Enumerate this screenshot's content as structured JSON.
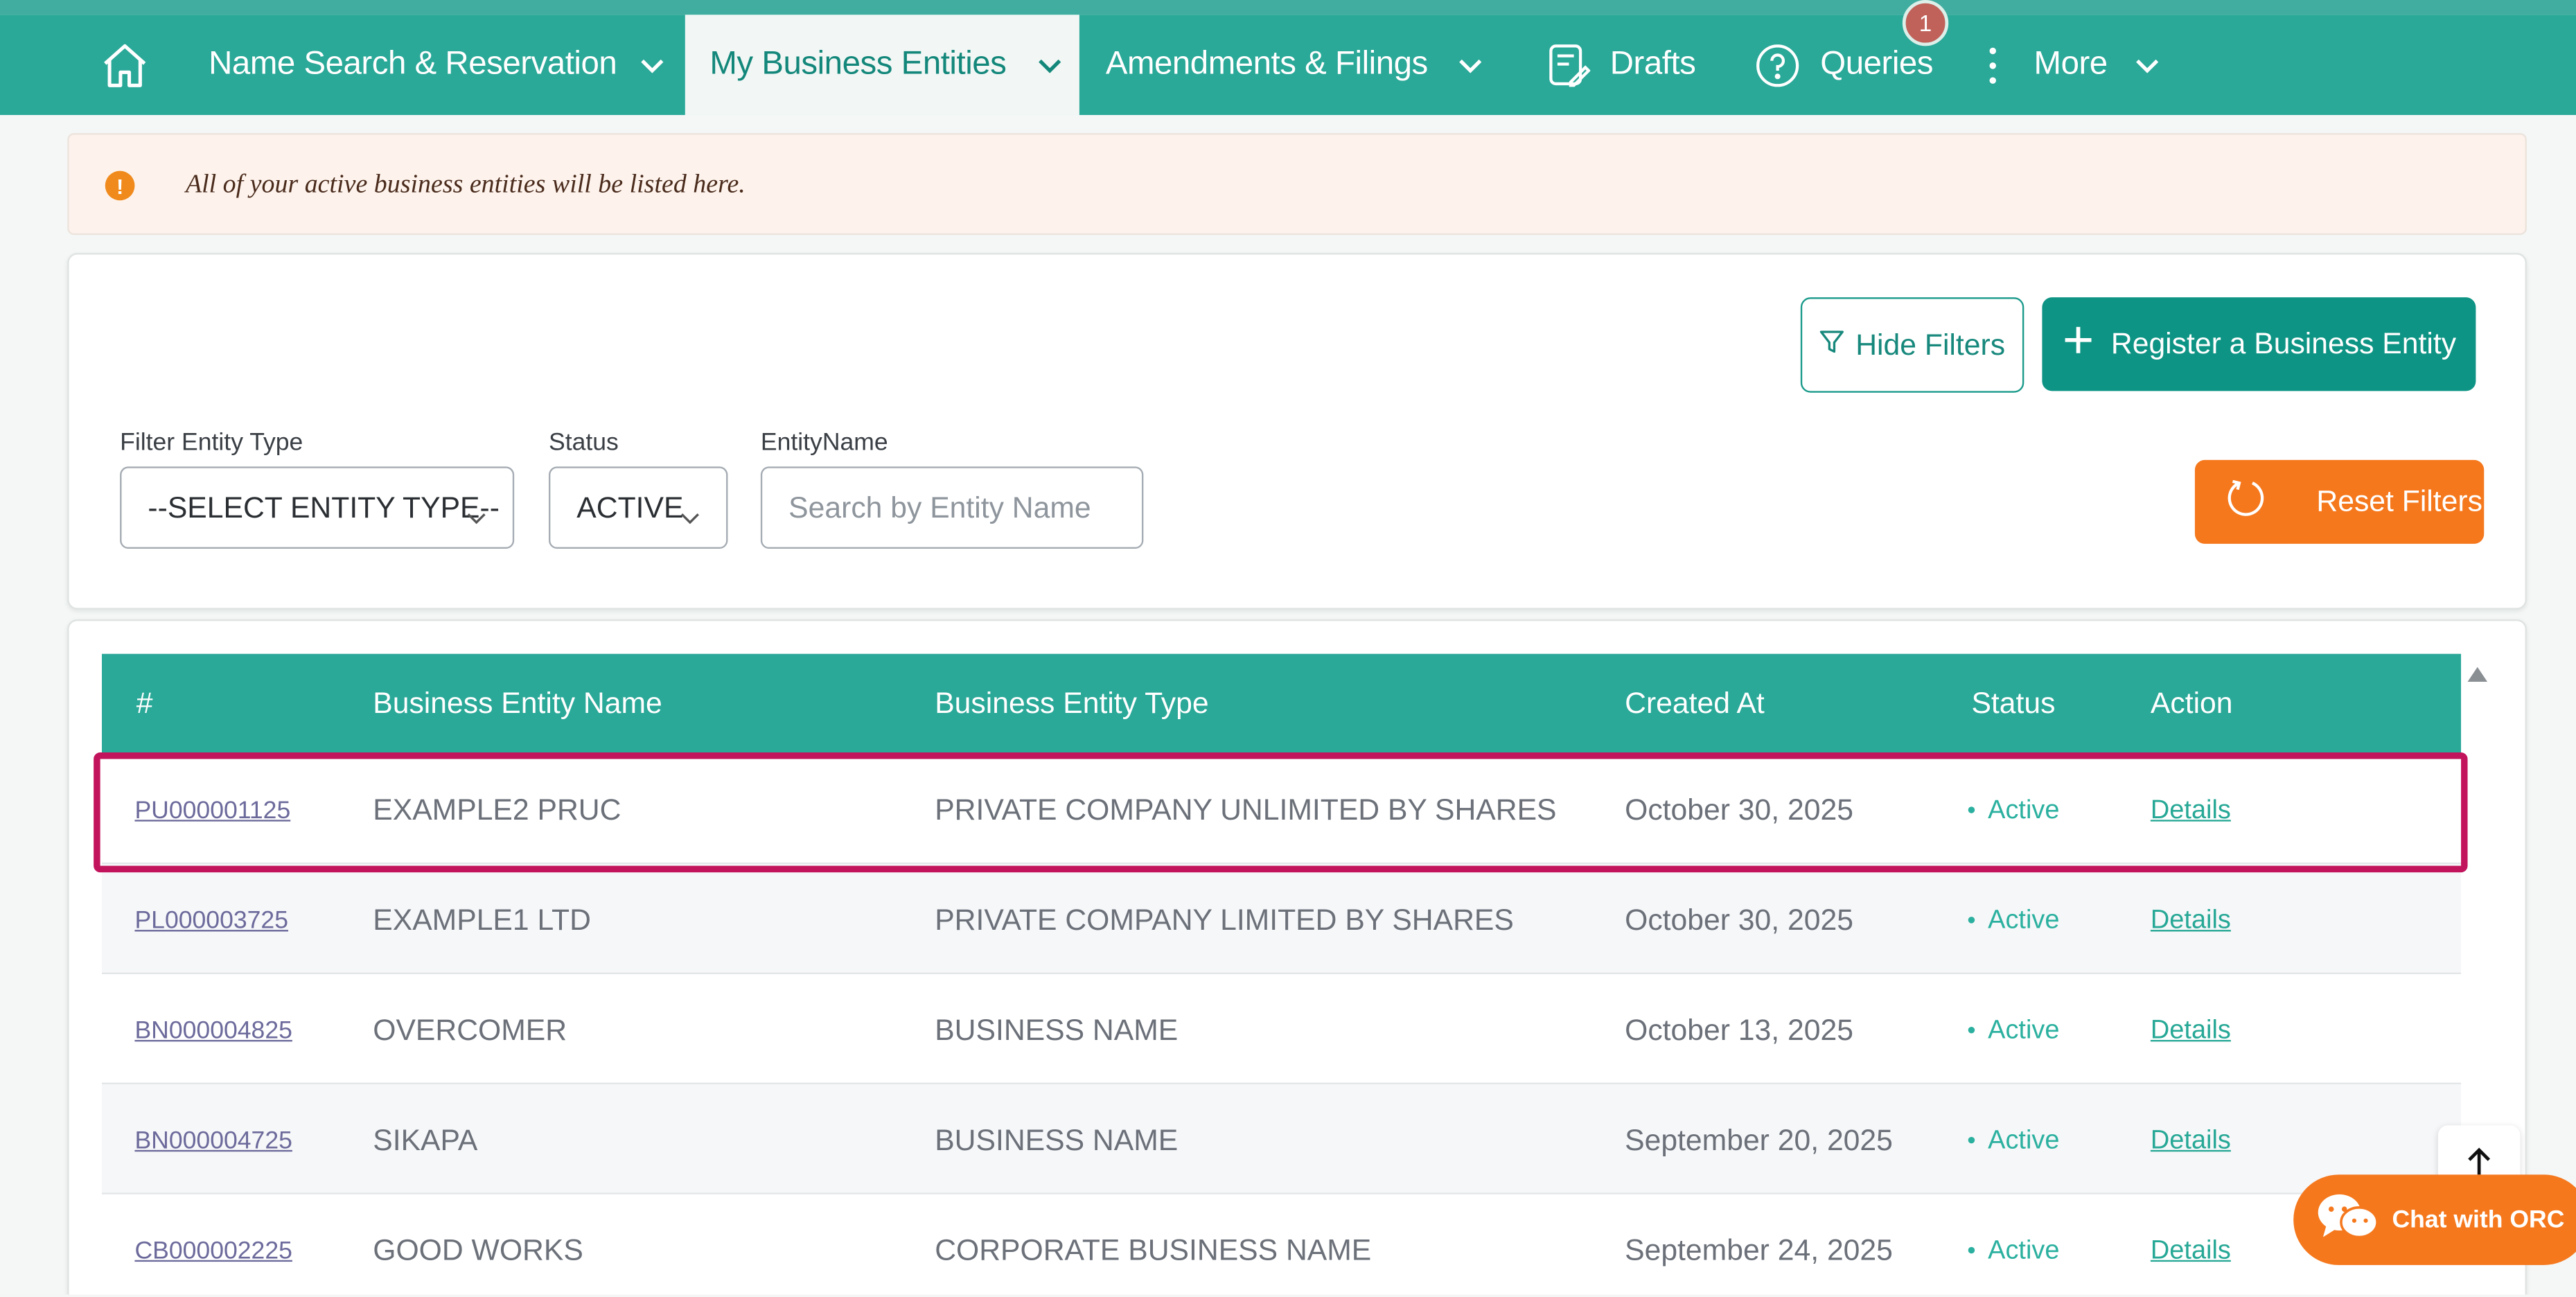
{
  "nav": {
    "home_icon": "home-icon",
    "items": [
      {
        "label": "Name Search & Reservation",
        "has_dropdown": true
      },
      {
        "label": "My Business Entities",
        "has_dropdown": true,
        "active": true
      },
      {
        "label": "Amendments & Filings",
        "has_dropdown": true
      },
      {
        "label": "Drafts",
        "icon": "document-edit-icon"
      },
      {
        "label": "Queries",
        "icon": "question-circle-icon",
        "badge": "1"
      },
      {
        "label": "More",
        "icon": "kebab-icon",
        "has_dropdown": true
      }
    ]
  },
  "alert": {
    "text": "All of your active business entities will be listed here.",
    "icon": "exclamation-circle-icon"
  },
  "filters": {
    "hide_label": "Hide Filters",
    "register_label": "Register a Business Entity",
    "reset_label": "Reset Filters",
    "entity_type_label": "Filter Entity Type",
    "entity_type_value": "--SELECT ENTITY TYPE--",
    "status_label": "Status",
    "status_value": "ACTIVE",
    "entity_name_label": "EntityName",
    "entity_name_placeholder": "Search by Entity Name"
  },
  "table": {
    "headers": [
      "#",
      "Business Entity Name",
      "Business Entity Type",
      "Created At",
      "Status",
      "Action"
    ],
    "rows": [
      {
        "id": "PU000001125",
        "name": "EXAMPLE2 PRUC",
        "type": "PRIVATE COMPANY UNLIMITED BY SHARES",
        "created": "October 30, 2025",
        "status": "Active",
        "action": "Details"
      },
      {
        "id": "PL000003725",
        "name": "EXAMPLE1 LTD",
        "type": "PRIVATE COMPANY LIMITED BY SHARES",
        "created": "October 30, 2025",
        "status": "Active",
        "action": "Details"
      },
      {
        "id": "BN000004825",
        "name": "OVERCOMER",
        "type": "BUSINESS NAME",
        "created": "October 13, 2025",
        "status": "Active",
        "action": "Details"
      },
      {
        "id": "BN000004725",
        "name": "SIKAPA",
        "type": "BUSINESS NAME",
        "created": "September 20, 2025",
        "status": "Active",
        "action": "Details"
      },
      {
        "id": "CB000002225",
        "name": "GOOD WORKS",
        "type": "CORPORATE BUSINESS NAME",
        "created": "September 24, 2025",
        "status": "Active",
        "action": "Details"
      }
    ]
  },
  "chat": {
    "label": "Chat with ORC",
    "icon": "chat-bubbles-icon"
  },
  "colors": {
    "primary": "#2aa898",
    "accent": "#f5781d",
    "highlight": "#c2145c"
  }
}
